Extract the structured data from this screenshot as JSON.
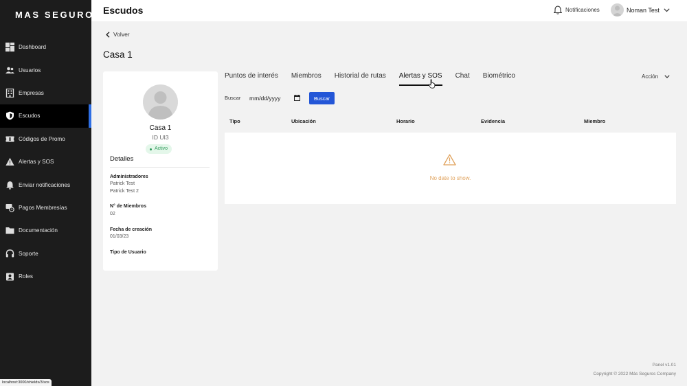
{
  "brand": {
    "logo": "MAS SEGUROS"
  },
  "sidebar": {
    "items": [
      {
        "label": "Dashboard",
        "icon": "dashboard-icon",
        "active": false
      },
      {
        "label": "Usuarios",
        "icon": "users-icon",
        "active": false
      },
      {
        "label": "Empresas",
        "icon": "building-icon",
        "active": false
      },
      {
        "label": "Escudos",
        "icon": "shield-icon",
        "active": true
      },
      {
        "label": "Códigos de Promo",
        "icon": "ticket-icon",
        "active": false
      },
      {
        "label": "Alertas y SOS",
        "icon": "warning-icon",
        "active": false
      },
      {
        "label": "Enviar notificaciones",
        "icon": "bell-icon",
        "active": false
      },
      {
        "label": "Pagos Membresías",
        "icon": "payment-icon",
        "active": false
      },
      {
        "label": "Documentación",
        "icon": "folder-icon",
        "active": false
      },
      {
        "label": "Soporte",
        "icon": "headset-icon",
        "active": false
      },
      {
        "label": "Roles",
        "icon": "badge-icon",
        "active": false
      }
    ]
  },
  "statusbar": {
    "url": "localhost:3000/shields/3/sos"
  },
  "header": {
    "title": "Escudos",
    "notifications_label": "Notificaciones",
    "user_name": "Noman Test"
  },
  "main": {
    "back_label": "Volver",
    "page_title": "Casa 1",
    "profile": {
      "name": "Casa 1",
      "id_text": "ID UI3",
      "status": "Activo",
      "details_heading": "Detalles",
      "admins_label": "Administradores",
      "admins": [
        "Patrick Test",
        "Patrick Test 2"
      ],
      "members_label": "N° de Miembros",
      "members_value": "02",
      "created_label": "Fecha de creación",
      "created_value": "01/03/23",
      "user_type_label": "Tipo de Usuario"
    },
    "tabs": [
      {
        "label": "Puntos de interés",
        "active": false
      },
      {
        "label": "Miembros",
        "active": false
      },
      {
        "label": "Historial de rutas",
        "active": false
      },
      {
        "label": "Alertas y SOS",
        "active": true
      },
      {
        "label": "Chat",
        "active": false
      },
      {
        "label": "Biométrico",
        "active": false
      }
    ],
    "action_label": "Acción",
    "search": {
      "label": "Buscar",
      "date_placeholder": "mm/dd/yyyy",
      "button_label": "Buscar"
    },
    "table": {
      "columns": [
        "Tipo",
        "Ubicación",
        "Horario",
        "Evidencia",
        "Miembro"
      ],
      "empty_text": "No date to show."
    }
  },
  "footer": {
    "version": "Panel v1.01",
    "copyright": "Copyright © 2022 Más Seguros Company"
  },
  "colors": {
    "sidebar_bg": "#1c1c1c",
    "accent": "#2356d7",
    "active_indicator": "#2f6fe4",
    "status_green": "#2e9a5a",
    "empty_text": "#e0a25c"
  }
}
